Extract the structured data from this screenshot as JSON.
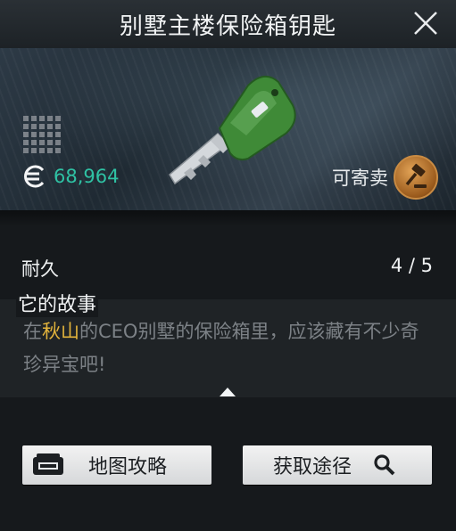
{
  "header": {
    "title": "别墅主楼保险箱钥匙"
  },
  "item": {
    "price": "68,964",
    "sellable_label": "可寄卖",
    "grid_size": "5x5"
  },
  "stats": {
    "durability_label": "耐久",
    "durability_value": "4 / 5"
  },
  "story": {
    "heading": "它的故事",
    "text_before": "在",
    "highlight": "秋山",
    "text_after": "的CEO别墅的保险箱里，应该藏有不少奇珍异宝吧!"
  },
  "actions": {
    "map_label": "地图攻略",
    "obtain_label": "获取途径"
  },
  "colors": {
    "price": "#2fc2a4",
    "highlight": "#e3b43c",
    "key_body": "#3f8a37"
  },
  "icons": [
    "close-icon",
    "grid-size-icon",
    "currency-icon",
    "auction-hammer-icon",
    "expand-arrow-icon",
    "map-icon",
    "search-icon"
  ]
}
